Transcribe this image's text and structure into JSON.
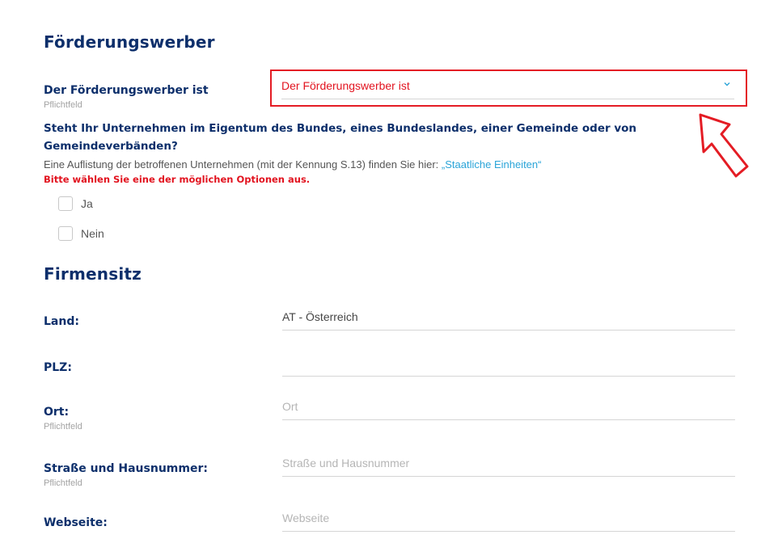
{
  "applicant": {
    "heading": "Förderungswerber",
    "type_label": "Der Förderungswerber ist",
    "type_hint": "Pflichtfeld",
    "type_select_value": "Der Förderungswerber ist",
    "ownership_question": "Steht Ihr Unternehmen im Eigentum des Bundes, eines Bundeslandes, einer Gemeinde oder von Gemeindeverbänden?",
    "info_prefix": "Eine Auflistung der betroffenen Unternehmen (mit der Kennung S.13) finden Sie hier: ",
    "info_link": "„Staatliche Einheiten“",
    "error": "Bitte wählen Sie eine der möglichen Optionen aus.",
    "options": [
      "Ja",
      "Nein"
    ]
  },
  "company_seat": {
    "heading": "Firmensitz",
    "country_label": "Land:",
    "country_value": "AT - Österreich",
    "zip_label": "PLZ:",
    "zip_value": "",
    "city_label": "Ort:",
    "city_hint": "Pflichtfeld",
    "city_placeholder": "Ort",
    "street_label": "Straße und Hausnummer:",
    "street_hint": "Pflichtfeld",
    "street_placeholder": "Straße und Hausnummer",
    "website_label": "Webseite:",
    "website_placeholder": "Webseite"
  },
  "colors": {
    "heading": "#0d2f6b",
    "error": "#e2131f",
    "link": "#2aa4d8",
    "highlight_box": "#e41c24"
  },
  "icons": {
    "select_arrow": "chevron-down-icon",
    "annotation": "arrow-pointer-icon"
  }
}
